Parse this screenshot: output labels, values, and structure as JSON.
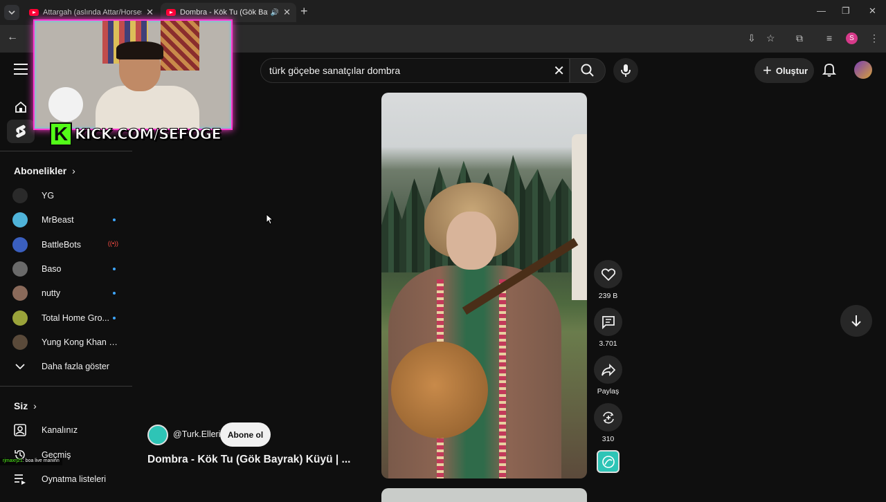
{
  "browser": {
    "tabs": [
      {
        "title": "Attargah (aslında Attar/Horses"
      },
      {
        "title": "Dombra - Kök Tu (Gök Bayrak"
      }
    ],
    "profile_initial": "S"
  },
  "header": {
    "search_query": "türk göçebe sanatçılar dombra",
    "create_label": "Oluştur"
  },
  "sidebar": {
    "subscriptions_title": "Abonelikler",
    "subscriptions": [
      {
        "name": "YG",
        "indicator": "",
        "color": "#2a2a2a"
      },
      {
        "name": "MrBeast",
        "indicator": "dot",
        "color": "#4fb3d9"
      },
      {
        "name": "BattleBots",
        "indicator": "live",
        "color": "#3a5fbf"
      },
      {
        "name": "Baso",
        "indicator": "dot",
        "color": "#6a6a6a"
      },
      {
        "name": "nutty",
        "indicator": "dot",
        "color": "#8a6a5a"
      },
      {
        "name": "Total Home Gro...",
        "indicator": "dot",
        "color": "#9aa33a"
      },
      {
        "name": "Yung Kong Khan - K...",
        "indicator": "",
        "color": "#5a4a3a"
      }
    ],
    "show_more": "Daha fazla göster",
    "you_title": "Siz",
    "you_items": [
      {
        "label": "Kanalınız",
        "icon": "channel-icon"
      },
      {
        "label": "Geçmiş",
        "icon": "history-icon"
      },
      {
        "label": "Oynatma listeleri",
        "icon": "playlists-icon"
      }
    ]
  },
  "overlay": {
    "kick_text": "KICK.COM/SEFOGE",
    "chat_user": "rjmaxrj21",
    "chat_message": ": boa live maninn"
  },
  "short": {
    "likes": "239 B",
    "comments": "3.701",
    "share_label": "Paylaş",
    "remix_count": "310",
    "channel_handle": "@Turk.Elleri",
    "subscribe_label": "Abone ol",
    "title": "Dombra - Kök Tu (Gök Bayrak) Küyü  | ..."
  }
}
